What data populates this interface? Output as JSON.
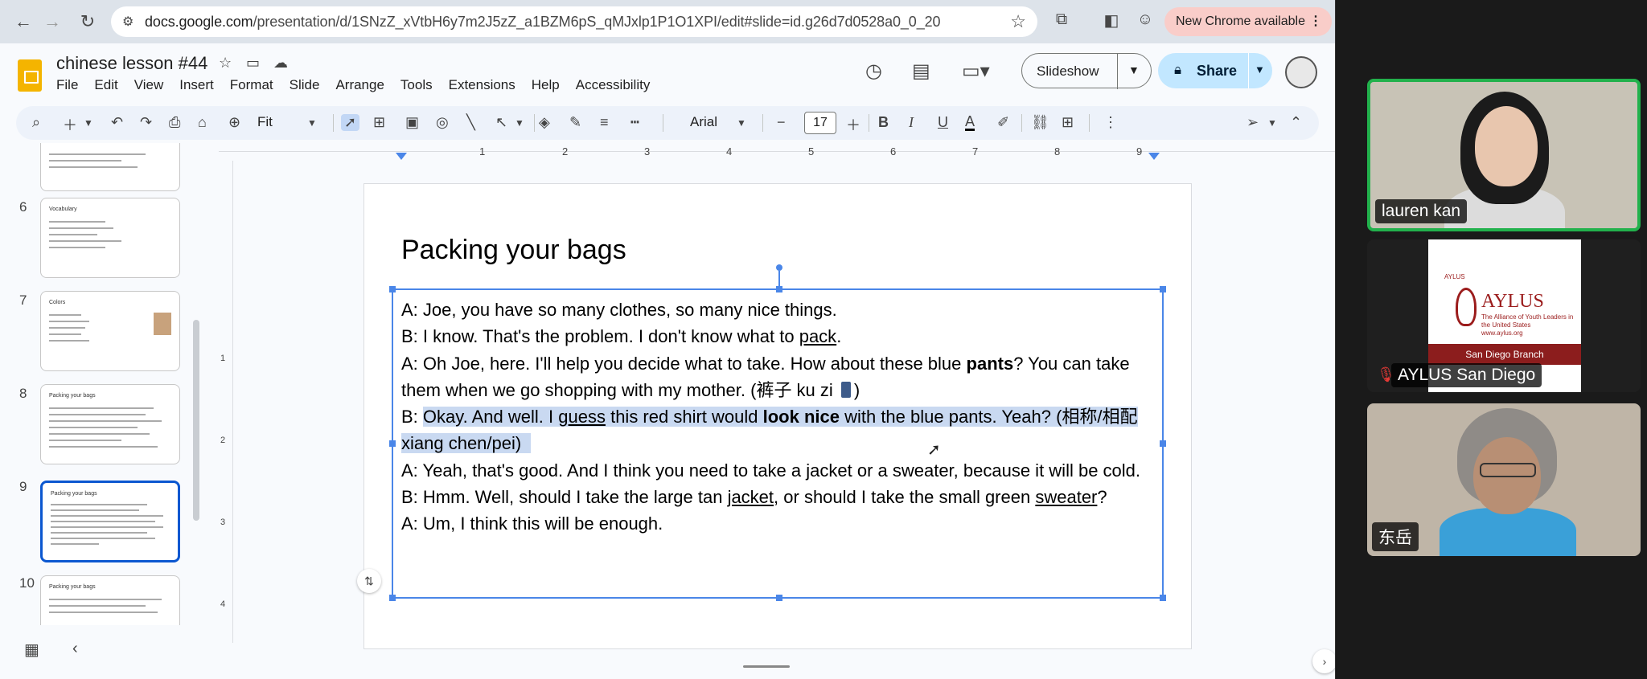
{
  "browser": {
    "url_host": "docs.google.com",
    "url_path": "/presentation/d/1SNzZ_xVtbH6y7m2J5zZ_a1BZM6pS_qMJxlp1P1O1XPI/edit#slide=id.g26d7d0528a0_0_20",
    "update_label": "New Chrome available",
    "update_menu_glyph": "⋮"
  },
  "app": {
    "doc_title": "chinese lesson #44",
    "menu": [
      "File",
      "Edit",
      "View",
      "Insert",
      "Format",
      "Slide",
      "Arrange",
      "Tools",
      "Extensions",
      "Help",
      "Accessibility"
    ],
    "slideshow_label": "Slideshow",
    "share_label": "Share"
  },
  "toolbar": {
    "zoom_value": "Fit",
    "font_family": "Arial",
    "font_size": "17"
  },
  "filmstrip": {
    "slides": [
      {
        "number": "6",
        "title": "Vocabulary"
      },
      {
        "number": "7",
        "title": "Colors"
      },
      {
        "number": "8",
        "title": "Packing your bags"
      },
      {
        "number": "9",
        "title": "Packing your bags"
      },
      {
        "number": "10",
        "title": "Packing your bags"
      }
    ],
    "selected_slide": "9"
  },
  "ruler": {
    "h_labels": [
      "1",
      "2",
      "3",
      "4",
      "5",
      "6",
      "7",
      "8",
      "9"
    ],
    "v_labels": [
      "1",
      "2",
      "3",
      "4"
    ]
  },
  "slide": {
    "title": "Packing your bags",
    "lines": {
      "l1": "A: Joe, you have so many clothes, so many nice things.",
      "l2a": "B: I know. That's the problem. I don't know what to ",
      "l2u": "pack",
      "l2b": ".",
      "l3a": "A: Oh Joe, here. I'll help you decide what to take. How about these blue ",
      "l3b": "pants",
      "l3c": "? You can take them when we go shopping with my mother. (裤子 ku zi ",
      "l3d": ")",
      "l4a": "B: ",
      "l4b": "Okay. And well. I ",
      "l4u": "guess",
      "l4c": " this red shirt would ",
      "l4bold": "look nice",
      "l4d": " with the blue pants. Yeah? (相称/相配 xiang chen/pei)",
      "l5": "A: Yeah, that's good. And I think you need to take a jacket or a sweater, because it will be cold.",
      "l6a": "B: Hmm. Well, should I take the large tan ",
      "l6u": "jacket",
      "l6b": ", or should I take the small green ",
      "l6u2": "sweater",
      "l6c": "?",
      "l7": "A: Um, I think this will be enough."
    }
  },
  "video": {
    "participants": [
      {
        "name": "lauren kan",
        "active": true
      },
      {
        "name": "AYLUS San Diego",
        "muted": true
      },
      {
        "name": "东岳"
      }
    ],
    "aylus_logo": {
      "word": "AYLUS",
      "small": "AYLUS",
      "subtitle": "The Alliance of Youth Leaders in the United States  www.aylus.org",
      "banner": "San Diego Branch"
    }
  },
  "colors": {
    "accent_blue": "#4a86e8",
    "share_bg": "#c2e7ff",
    "update_bg": "#f9cdc9",
    "active_speaker": "#22b14c",
    "aylus_red": "#8c1d1d"
  }
}
